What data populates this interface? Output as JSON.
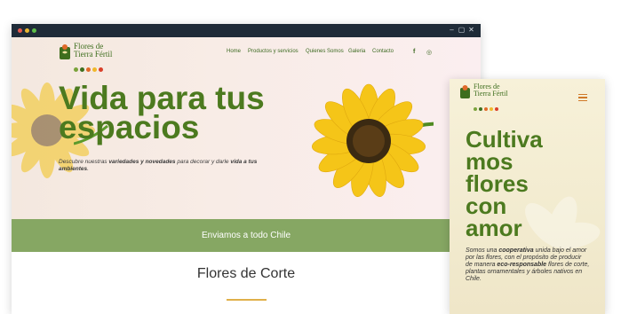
{
  "desktop": {
    "logo": {
      "line1": "Flores de",
      "line2": "Tierra Fértil"
    },
    "nav": {
      "home": "Home",
      "productos": "Productos y servicios",
      "quienes": "Quienes Somos",
      "galeria": "Galeria",
      "contacto": "Contacto"
    },
    "social": {
      "facebook": "f",
      "instagram": "◎"
    },
    "hero": {
      "title_line1": "Vida para tus",
      "title_line2": "espacios",
      "sub_a": "Descubre nuestras ",
      "sub_b": "variedades y novedades",
      "sub_c": " para decorar y darle ",
      "sub_d": "vida a tus ambientes",
      "sub_e": "."
    },
    "band": "Enviamos a todo Chile",
    "section_title": "Flores de Corte"
  },
  "mobile": {
    "logo": {
      "line1": "Flores de",
      "line2": "Tierra Fértil"
    },
    "title": [
      "Cultiva",
      "mos",
      "flores",
      "con",
      "amor"
    ],
    "sub": {
      "a": "Somos una ",
      "b": "cooperativa",
      "c": " unida bajo el amor por las flores, con el propósito de producir de manera ",
      "d": "eco-responsable",
      "e": " flores de corte, plantas ornamentales y árboles nativos en Chile."
    }
  },
  "colors": {
    "brand_green": "#4c7a1f",
    "band_green": "#86a763",
    "accent_orange": "#e0b04a",
    "titlebar": "#1f2b38"
  },
  "logo_dot_colors": [
    "#7aa33a",
    "#3e6e1e",
    "#e06a2a",
    "#f0b82a",
    "#d9402a"
  ]
}
